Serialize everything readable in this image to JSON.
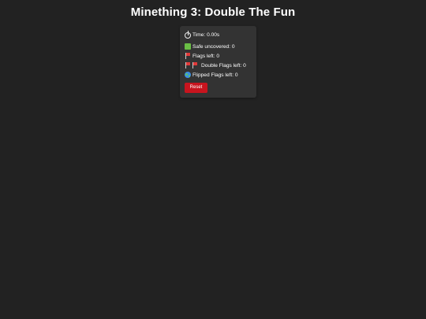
{
  "game": {
    "title": "Minething 3: Double The Fun"
  },
  "stats": {
    "time": {
      "icon": "stopwatch-icon",
      "label": "Time: 0.00s"
    },
    "safe_uncovered": {
      "icon": "green-square-icon",
      "label": "Safe uncovered: 0"
    },
    "flags_left": {
      "icon": "red-flag-icon",
      "label": "Flags left: 0"
    },
    "double_flags_left": {
      "icon": "double-red-flag-icon",
      "label": "Double Flags left: 0"
    },
    "flipped_flags_left": {
      "icon": "globe-icon",
      "label": "Flipped Flags left: 0"
    }
  },
  "controls": {
    "reset_label": "Reset"
  },
  "colors": {
    "background": "#222222",
    "panel": "#333333",
    "reset_button": "#c8141e",
    "flag": "#e03a3a",
    "safe": "#6abe45",
    "globe": "#3a8ee6"
  }
}
